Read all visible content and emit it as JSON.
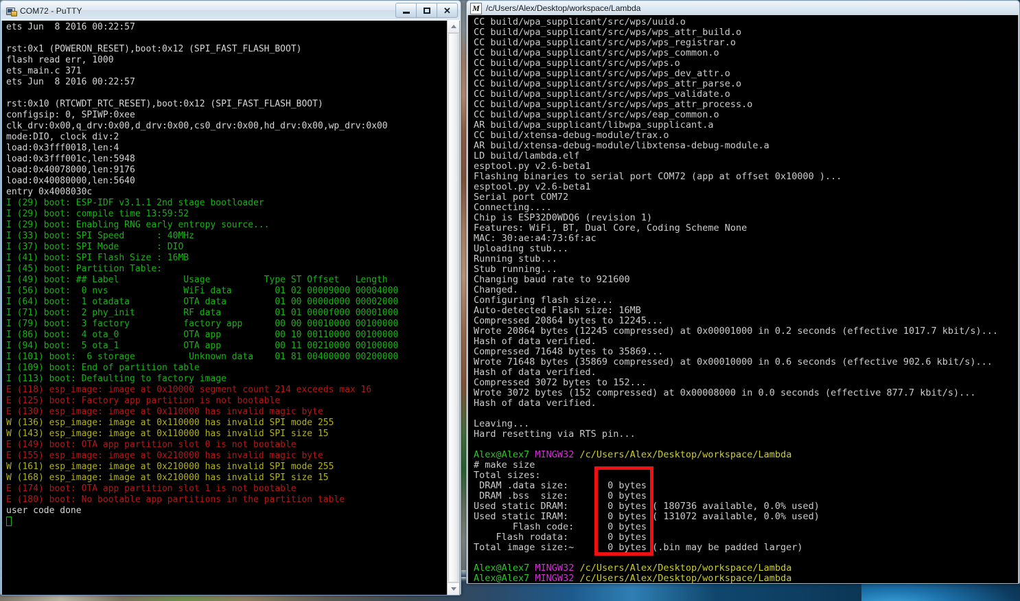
{
  "desktop": {
    "wallpaper_alt": "photo-wallpaper-strip"
  },
  "putty_window": {
    "title": "COM72 - PuTTY",
    "icon": "putty-computer-plug-icon",
    "buttons": {
      "minimize": "Minimize",
      "maximize": "Restore",
      "close": "Close"
    },
    "scrollbar": {
      "up_arrow": "scroll-up",
      "down_arrow": "scroll-down"
    },
    "terminal_lines": [
      {
        "text": "ets Jun  8 2016 00:22:57",
        "color": "white"
      },
      {
        "text": "",
        "color": "white"
      },
      {
        "text": "rst:0x1 (POWERON_RESET),boot:0x12 (SPI_FAST_FLASH_BOOT)",
        "color": "white"
      },
      {
        "text": "flash read err, 1000",
        "color": "white"
      },
      {
        "text": "ets_main.c 371",
        "color": "white"
      },
      {
        "text": "ets Jun  8 2016 00:22:57",
        "color": "white"
      },
      {
        "text": "",
        "color": "white"
      },
      {
        "text": "rst:0x10 (RTCWDT_RTC_RESET),boot:0x12 (SPI_FAST_FLASH_BOOT)",
        "color": "white"
      },
      {
        "text": "configsip: 0, SPIWP:0xee",
        "color": "white"
      },
      {
        "text": "clk_drv:0x00,q_drv:0x00,d_drv:0x00,cs0_drv:0x00,hd_drv:0x00,wp_drv:0x00",
        "color": "white"
      },
      {
        "text": "mode:DIO, clock div:2",
        "color": "white"
      },
      {
        "text": "load:0x3fff0018,len:4",
        "color": "white"
      },
      {
        "text": "load:0x3fff001c,len:5948",
        "color": "white"
      },
      {
        "text": "load:0x40078000,len:9176",
        "color": "white"
      },
      {
        "text": "load:0x40080000,len:5640",
        "color": "white"
      },
      {
        "text": "entry 0x4008030c",
        "color": "white"
      },
      {
        "text": "I (29) boot: ESP-IDF v3.1.1 2nd stage bootloader",
        "color": "green"
      },
      {
        "text": "I (29) boot: compile time 13:59:52",
        "color": "green"
      },
      {
        "text": "I (29) boot: Enabling RNG early entropy source...",
        "color": "green"
      },
      {
        "text": "I (33) boot: SPI Speed      : 40MHz",
        "color": "green"
      },
      {
        "text": "I (37) boot: SPI Mode       : DIO",
        "color": "green"
      },
      {
        "text": "I (41) boot: SPI Flash Size : 16MB",
        "color": "green"
      },
      {
        "text": "I (45) boot: Partition Table:",
        "color": "green"
      },
      {
        "text": "I (49) boot: ## Label            Usage          Type ST Offset   Length",
        "color": "green"
      },
      {
        "text": "I (56) boot:  0 nvs              WiFi data        01 02 00009000 00004000",
        "color": "green"
      },
      {
        "text": "I (64) boot:  1 otadata          OTA data         01 00 0000d000 00002000",
        "color": "green"
      },
      {
        "text": "I (71) boot:  2 phy_init         RF data          01 01 0000f000 00001000",
        "color": "green"
      },
      {
        "text": "I (79) boot:  3 factory          factory app      00 00 00010000 00100000",
        "color": "green"
      },
      {
        "text": "I (86) boot:  4 ota_0            OTA app          00 10 00110000 00100000",
        "color": "green"
      },
      {
        "text": "I (94) boot:  5 ota_1            OTA app          00 11 00210000 00100000",
        "color": "green"
      },
      {
        "text": "I (101) boot:  6 storage          Unknown data    01 81 00400000 00200000",
        "color": "green"
      },
      {
        "text": "I (109) boot: End of partition table",
        "color": "green"
      },
      {
        "text": "I (113) boot: Defaulting to factory image",
        "color": "green"
      },
      {
        "text": "E (118) esp_image: image at 0x10000 segment count 214 exceeds max 16",
        "color": "red"
      },
      {
        "text": "E (125) boot: Factory app partition is not bootable",
        "color": "red"
      },
      {
        "text": "E (130) esp_image: image at 0x110000 has invalid magic byte",
        "color": "red"
      },
      {
        "text": "W (136) esp_image: image at 0x110000 has invalid SPI mode 255",
        "color": "yellow"
      },
      {
        "text": "W (143) esp_image: image at 0x110000 has invalid SPI size 15",
        "color": "yellow"
      },
      {
        "text": "E (149) boot: OTA app partition slot 0 is not bootable",
        "color": "red"
      },
      {
        "text": "E (155) esp_image: image at 0x210000 has invalid magic byte",
        "color": "red"
      },
      {
        "text": "W (161) esp_image: image at 0x210000 has invalid SPI mode 255",
        "color": "yellow"
      },
      {
        "text": "W (168) esp_image: image at 0x210000 has invalid SPI size 15",
        "color": "yellow"
      },
      {
        "text": "E (174) boot: OTA app partition slot 1 is not bootable",
        "color": "red"
      },
      {
        "text": "E (180) boot: No bootable app partitions in the partition table",
        "color": "red"
      },
      {
        "text": "user code done",
        "color": "white"
      },
      {
        "text": "__CURSOR__",
        "color": "green"
      }
    ]
  },
  "mingw_window": {
    "title": "/c/Users/Alex/Desktop/workspace/Lambda",
    "icon": "mingw-m-icon",
    "terminal_lines": [
      {
        "text": "CC build/wpa_supplicant/src/wps/uuid.o",
        "color": "plain"
      },
      {
        "text": "CC build/wpa_supplicant/src/wps/wps_attr_build.o",
        "color": "plain"
      },
      {
        "text": "CC build/wpa_supplicant/src/wps/wps_registrar.o",
        "color": "plain"
      },
      {
        "text": "CC build/wpa_supplicant/src/wps/wps_common.o",
        "color": "plain"
      },
      {
        "text": "CC build/wpa_supplicant/src/wps/wps.o",
        "color": "plain"
      },
      {
        "text": "CC build/wpa_supplicant/src/wps/wps_dev_attr.o",
        "color": "plain"
      },
      {
        "text": "CC build/wpa_supplicant/src/wps/wps_attr_parse.o",
        "color": "plain"
      },
      {
        "text": "CC build/wpa_supplicant/src/wps/wps_validate.o",
        "color": "plain"
      },
      {
        "text": "CC build/wpa_supplicant/src/wps/wps_attr_process.o",
        "color": "plain"
      },
      {
        "text": "CC build/wpa_supplicant/src/wps/eap_common.o",
        "color": "plain"
      },
      {
        "text": "AR build/wpa_supplicant/libwpa_supplicant.a",
        "color": "plain"
      },
      {
        "text": "CC build/xtensa-debug-module/trax.o",
        "color": "plain"
      },
      {
        "text": "AR build/xtensa-debug-module/libxtensa-debug-module.a",
        "color": "plain"
      },
      {
        "text": "LD build/lambda.elf",
        "color": "plain"
      },
      {
        "text": "esptool.py v2.6-beta1",
        "color": "plain"
      },
      {
        "text": "Flashing binaries to serial port COM72 (app at offset 0x10000 )...",
        "color": "plain"
      },
      {
        "text": "esptool.py v2.6-beta1",
        "color": "plain"
      },
      {
        "text": "Serial port COM72",
        "color": "plain"
      },
      {
        "text": "Connecting....",
        "color": "plain"
      },
      {
        "text": "Chip is ESP32D0WDQ6 (revision 1)",
        "color": "plain"
      },
      {
        "text": "Features: WiFi, BT, Dual Core, Coding Scheme None",
        "color": "plain"
      },
      {
        "text": "MAC: 30:ae:a4:73:6f:ac",
        "color": "plain"
      },
      {
        "text": "Uploading stub...",
        "color": "plain"
      },
      {
        "text": "Running stub...",
        "color": "plain"
      },
      {
        "text": "Stub running...",
        "color": "plain"
      },
      {
        "text": "Changing baud rate to 921600",
        "color": "plain"
      },
      {
        "text": "Changed.",
        "color": "plain"
      },
      {
        "text": "Configuring flash size...",
        "color": "plain"
      },
      {
        "text": "Auto-detected Flash size: 16MB",
        "color": "plain"
      },
      {
        "text": "Compressed 20864 bytes to 12245...",
        "color": "plain"
      },
      {
        "text": "Wrote 20864 bytes (12245 compressed) at 0x00001000 in 0.2 seconds (effective 1017.7 kbit/s)...",
        "color": "plain"
      },
      {
        "text": "Hash of data verified.",
        "color": "plain"
      },
      {
        "text": "Compressed 71648 bytes to 35869...",
        "color": "plain"
      },
      {
        "text": "Wrote 71648 bytes (35869 compressed) at 0x00010000 in 0.6 seconds (effective 902.6 kbit/s)...",
        "color": "plain"
      },
      {
        "text": "Hash of data verified.",
        "color": "plain"
      },
      {
        "text": "Compressed 3072 bytes to 152...",
        "color": "plain"
      },
      {
        "text": "Wrote 3072 bytes (152 compressed) at 0x00008000 in 0.0 seconds (effective 877.7 kbit/s)...",
        "color": "plain"
      },
      {
        "text": "Hash of data verified.",
        "color": "plain"
      },
      {
        "text": "",
        "color": "plain"
      },
      {
        "text": "Leaving...",
        "color": "plain"
      },
      {
        "text": "Hard resetting via RTS pin...",
        "color": "plain"
      },
      {
        "text": "",
        "color": "plain"
      },
      {
        "text": "__PROMPT__",
        "color": "prompt"
      },
      {
        "text": "# make size",
        "color": "plain"
      },
      {
        "text": "Total sizes:",
        "color": "plain"
      },
      {
        "text": " DRAM .data size:       0 bytes",
        "color": "plain"
      },
      {
        "text": " DRAM .bss  size:       0 bytes",
        "color": "plain"
      },
      {
        "text": "Used static DRAM:       0 bytes ( 180736 available, 0.0% used)",
        "color": "plain"
      },
      {
        "text": "Used static IRAM:       0 bytes ( 131072 available, 0.0% used)",
        "color": "plain"
      },
      {
        "text": "       Flash code:      0 bytes",
        "color": "plain"
      },
      {
        "text": "    Flash rodata:       0 bytes",
        "color": "plain"
      },
      {
        "text": "Total image size:~      0 bytes (.bin may be padded larger)",
        "color": "plain"
      },
      {
        "text": "",
        "color": "plain"
      },
      {
        "text": "__PROMPT__",
        "color": "prompt"
      },
      {
        "text": "__PROMPT_CURSOR__",
        "color": "plain"
      }
    ],
    "prompt": {
      "user": "Alex@Alex7",
      "host": "MINGW32",
      "path": "/c/Users/Alex/Desktop/workspace/Lambda",
      "symbol": "#"
    }
  },
  "annotation": {
    "highlight_color": "#ee1111",
    "label": "size-column-highlight"
  }
}
